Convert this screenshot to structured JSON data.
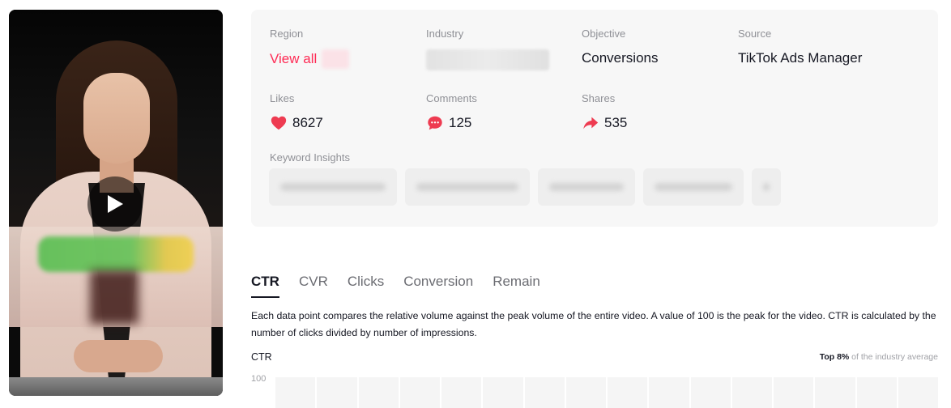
{
  "video": {
    "play_icon": "play-icon"
  },
  "info": {
    "region": {
      "label": "Region",
      "value": "View all"
    },
    "industry": {
      "label": "Industry"
    },
    "objective": {
      "label": "Objective",
      "value": "Conversions"
    },
    "source": {
      "label": "Source",
      "value": "TikTok Ads Manager"
    },
    "likes": {
      "label": "Likes",
      "value": "8627",
      "icon": "heart-icon",
      "color": "#fe2c55"
    },
    "comments": {
      "label": "Comments",
      "value": "125",
      "icon": "comment-icon",
      "color": "#fe2c55"
    },
    "shares": {
      "label": "Shares",
      "value": "535",
      "icon": "share-icon",
      "color": "#fe2c55"
    },
    "keyword_insights": {
      "label": "Keyword Insights"
    }
  },
  "tabs": [
    {
      "label": "CTR",
      "active": true
    },
    {
      "label": "CVR",
      "active": false
    },
    {
      "label": "Clicks",
      "active": false
    },
    {
      "label": "Conversion",
      "active": false
    },
    {
      "label": "Remain",
      "active": false
    }
  ],
  "description": "Each data point compares the relative volume against the peak volume of the entire video. A value of 100 is the peak for the video. CTR is calculated by the number of clicks divided by number of impressions.",
  "ctr": {
    "title": "CTR",
    "top_label": "Top 8%",
    "industry_note": "of the industry average",
    "y_max_label": "100"
  },
  "colors": {
    "accent": "#fe2c55",
    "text": "#161823",
    "muted": "#8f9096"
  }
}
